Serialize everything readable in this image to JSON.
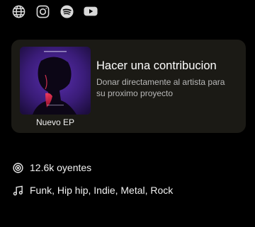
{
  "social_links": [
    {
      "icon": "globe-icon"
    },
    {
      "icon": "instagram-icon"
    },
    {
      "icon": "spotify-icon"
    },
    {
      "icon": "youtube-icon"
    }
  ],
  "contribution_card": {
    "title": "Hacer una contribucion",
    "description": "Donar directamente al artista para su proximo proyecto",
    "cover_caption": "Nuevo EP",
    "background_color": "#1b1a15"
  },
  "stats": {
    "listeners": "12.6k oyentes",
    "genres": "Funk, Hip hip, Indie, Metal, Rock"
  },
  "colors": {
    "background": "#000000",
    "text_primary": "#f2f2f2",
    "text_secondary": "#b8b8b8",
    "cover_purple": "#6b3cc4",
    "cover_red": "#e8284a"
  }
}
